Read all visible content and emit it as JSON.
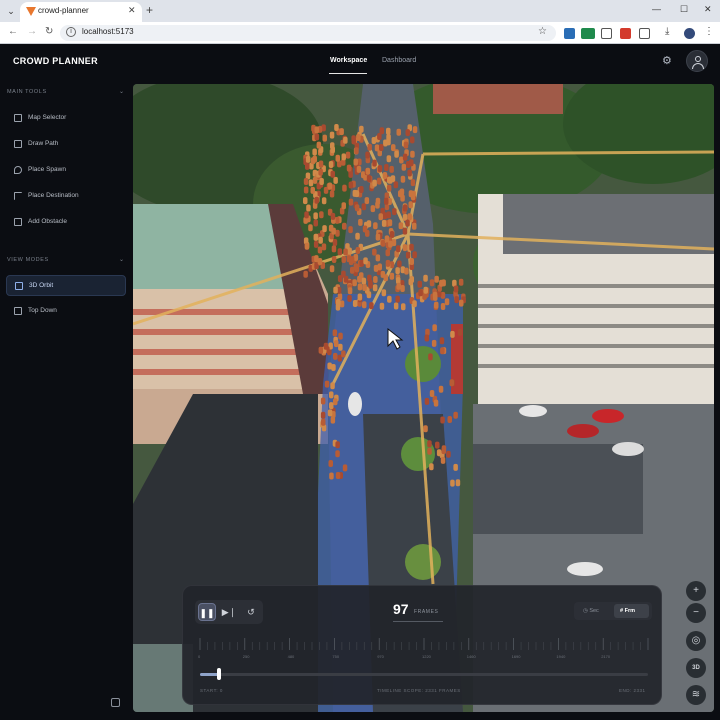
{
  "browser": {
    "tab_title": "crowd-planner",
    "url": "localhost:5173"
  },
  "app": {
    "brand": "CROWD PLANNER",
    "nav": [
      {
        "label": "Workspace",
        "active": true
      },
      {
        "label": "Dashboard",
        "active": false
      }
    ]
  },
  "sidebar": {
    "main_tools_title": "MAIN TOOLS",
    "main_tools": [
      {
        "label": "Map Selector",
        "icon": "map-icon"
      },
      {
        "label": "Draw Path",
        "icon": "path-icon"
      },
      {
        "label": "Place Spawn",
        "icon": "pin-icon"
      },
      {
        "label": "Place Destination",
        "icon": "flag-icon"
      },
      {
        "label": "Add Obstacle",
        "icon": "square-icon"
      }
    ],
    "view_modes_title": "VIEW MODES",
    "view_modes": [
      {
        "label": "3D Orbit",
        "icon": "cube-icon",
        "active": true
      },
      {
        "label": "Top Down",
        "icon": "map-icon",
        "active": false
      }
    ]
  },
  "map_controls": {
    "zoom_in": "+",
    "zoom_out": "−",
    "mode_3d": "3D"
  },
  "timeline": {
    "current_frame": "97",
    "frames_label": "FRAMES",
    "unit_sec": "Sec",
    "unit_frm": "Frm",
    "active_unit": "Frm",
    "tick_labels": [
      "0",
      "250",
      "480",
      "750",
      "970",
      "1220",
      "1460",
      "1690",
      "1940",
      "2170"
    ],
    "start_label": "START: 0",
    "scope_label": "TIMELINE SCOPE: 2331 FRAMES",
    "end_label": "END: 2331",
    "total_frames": 2331,
    "progress_fraction": 0.042
  },
  "colors": {
    "accent": "#8fa3c9",
    "path": "#e2b15c",
    "agent": "#c8743e",
    "zone": "#3f5fae"
  }
}
